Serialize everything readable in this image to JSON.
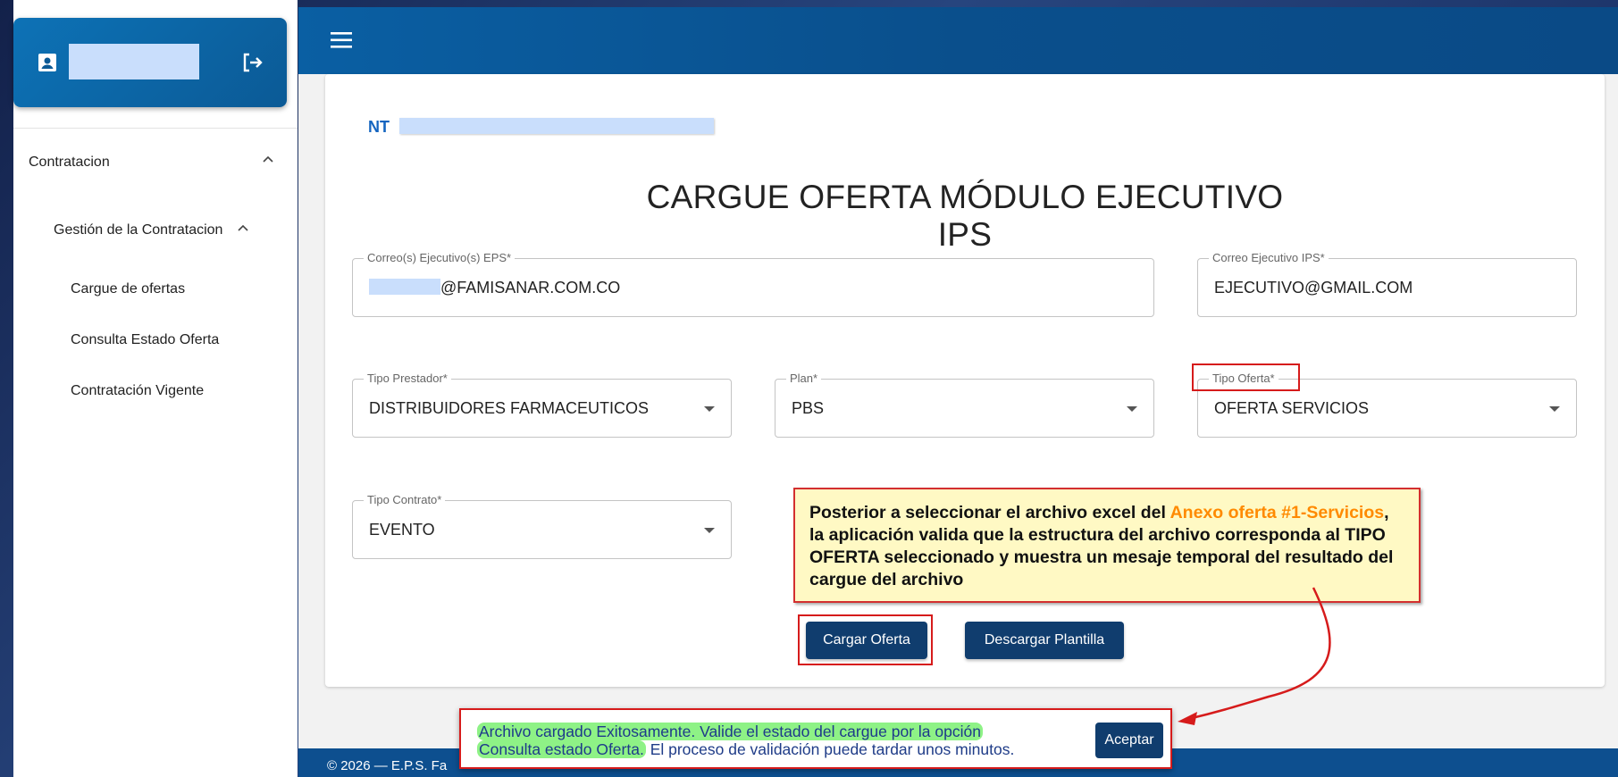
{
  "sidebar": {
    "items": [
      {
        "label": "Contratacion"
      },
      {
        "label": "Gestión de la Contratacion"
      },
      {
        "label": "Cargue de ofertas"
      },
      {
        "label": "Consulta Estado Oferta"
      },
      {
        "label": "Contratación Vigente"
      }
    ]
  },
  "header": {
    "nt_label": "NT",
    "title": "CARGUE OFERTA MÓDULO EJECUTIVO IPS"
  },
  "form": {
    "correo_eps": {
      "label": "Correo(s) Ejecutivo(s) EPS*",
      "value": "@FAMISANAR.COM.CO"
    },
    "correo_ips": {
      "label": "Correo Ejecutivo IPS*",
      "value": "EJECUTIVO@GMAIL.COM"
    },
    "tipo_prestador": {
      "label": "Tipo Prestador*",
      "value": "DISTRIBUIDORES FARMACEUTICOS"
    },
    "plan": {
      "label": "Plan*",
      "value": "PBS"
    },
    "tipo_oferta": {
      "label": "Tipo Oferta*",
      "value": "OFERTA SERVICIOS"
    },
    "tipo_contrato": {
      "label": "Tipo Contrato*",
      "value": "EVENTO"
    }
  },
  "buttons": {
    "cargar": "Cargar Oferta",
    "descargar": "Descargar Plantilla",
    "aceptar": "Aceptar"
  },
  "callout": {
    "part1": "Posterior a seleccionar el archivo excel del ",
    "highlight": "Anexo oferta #1-Servicios",
    "part2": ", la aplicación valida que la estructura del archivo corresponda al TIPO OFERTA seleccionado y muestra un mesaje temporal del resultado del cargue del archivo"
  },
  "snackbar": {
    "line1": "Archivo cargado Exitosamente. Valide el estado del cargue por la opción",
    "line2_hl": "Consulta estado Oferta.",
    "line2_rest": " El proceso de validación puede tardar unos minutos."
  },
  "footer": {
    "text": "© 2026 — E.P.S. Fa"
  },
  "colors": {
    "primary": "#103d6e",
    "topbar": "#0a5fa3",
    "annotation_red": "#d61b1b",
    "callout_bg": "#fff9c4",
    "callout_highlight": "#ff8a00",
    "success_highlight": "#8ef286"
  },
  "icons": {
    "user": "badge-icon",
    "logout": "logout-icon",
    "menu": "hamburger-icon",
    "expand": "chevron-up-icon",
    "select": "caret-down-icon"
  }
}
